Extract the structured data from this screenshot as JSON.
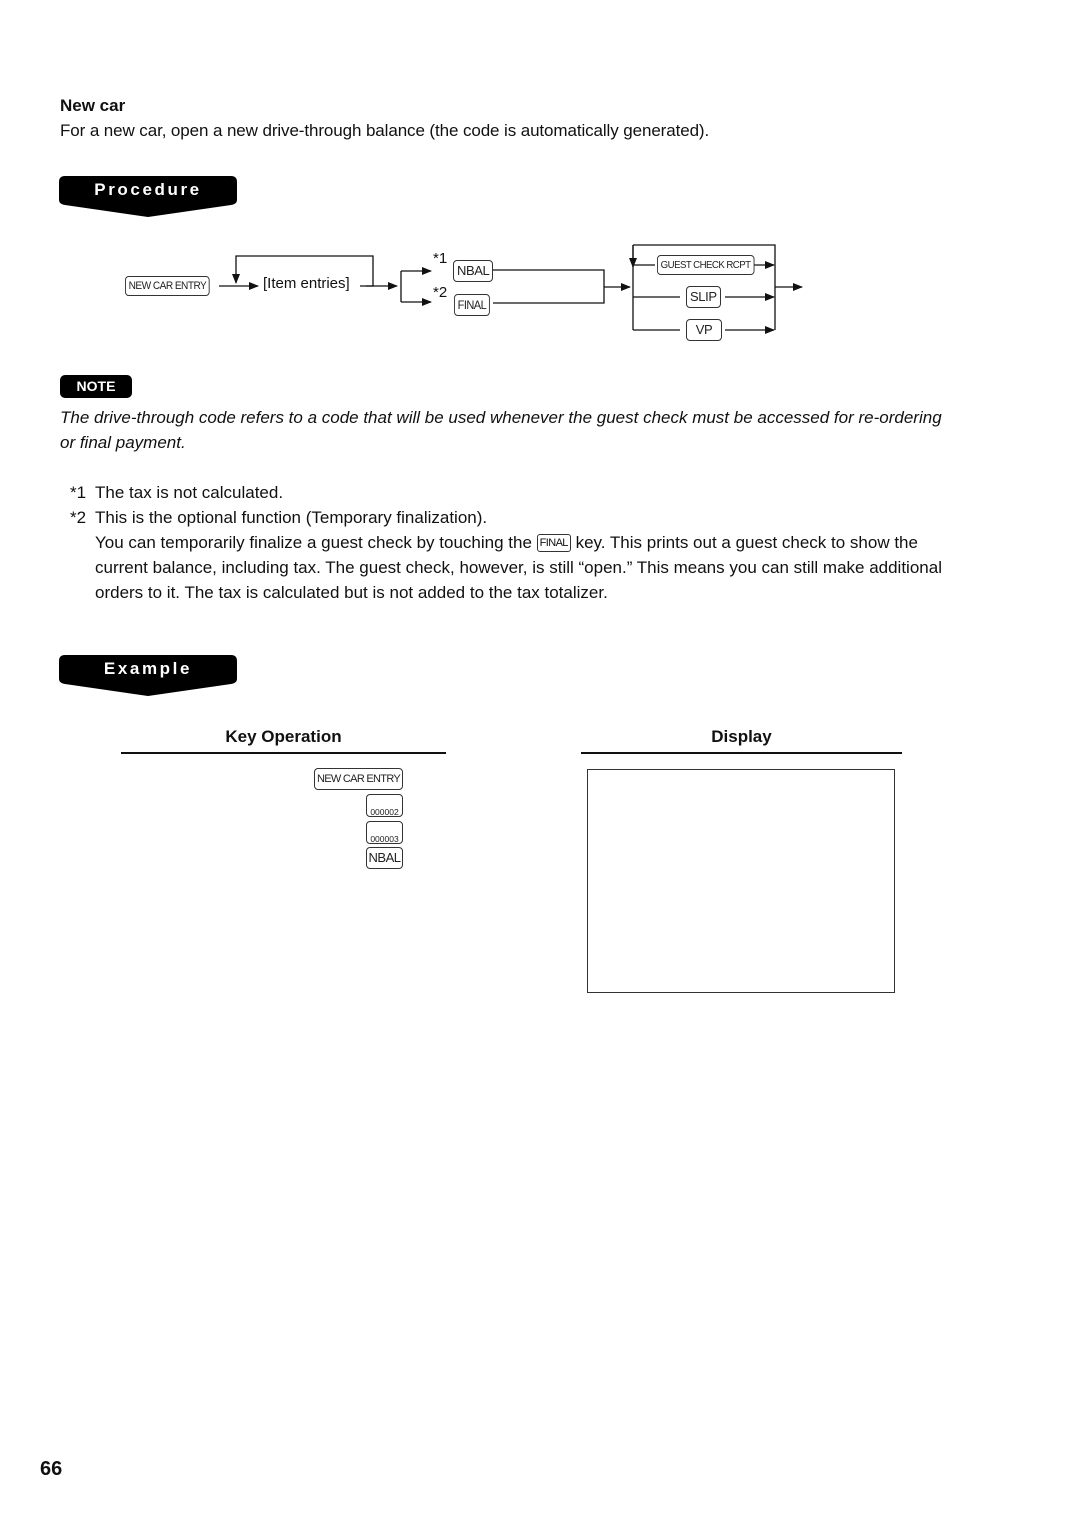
{
  "section": {
    "title": "New car",
    "intro": "For a new car, open a new drive-through balance (the code is automatically generated)."
  },
  "procedure": {
    "banner_label": "Procedure",
    "keys": {
      "new_car_entry": "NEW CAR ENTRY",
      "item_entries": "[Item entries]",
      "nbal": "NBAL",
      "final": "FINAL",
      "guest_check_rcpt": "GUEST CHECK RCPT",
      "slip": "SLIP",
      "vp": "VP"
    },
    "footnote_marks": [
      "*1",
      "*2"
    ]
  },
  "note": {
    "badge": "NOTE",
    "text": "The drive-through code refers to a code that will be used whenever the guest check must be accessed for re-ordering or final payment."
  },
  "footnotes": [
    {
      "mark": "*1",
      "text": "The tax is not calculated."
    },
    {
      "mark": "*2",
      "text": "This is the optional function (Temporary finalization).",
      "detail_before_key": "You can temporarily finalize a guest check by touching the",
      "detail_key": "FINAL",
      "detail_after_key": "key.  This prints out a guest check to show the current balance, including tax.  The guest check, however, is still “open.”  This means you can still make additional orders to it.  The tax is calculated but is not added to the tax totalizer."
    }
  ],
  "example": {
    "banner_label": "Example",
    "key_operation_header": "Key Operation",
    "display_header": "Display",
    "key_sequence": [
      "NEW CAR ENTRY",
      "000002",
      "000003",
      "NBAL"
    ]
  },
  "page_number": "66"
}
